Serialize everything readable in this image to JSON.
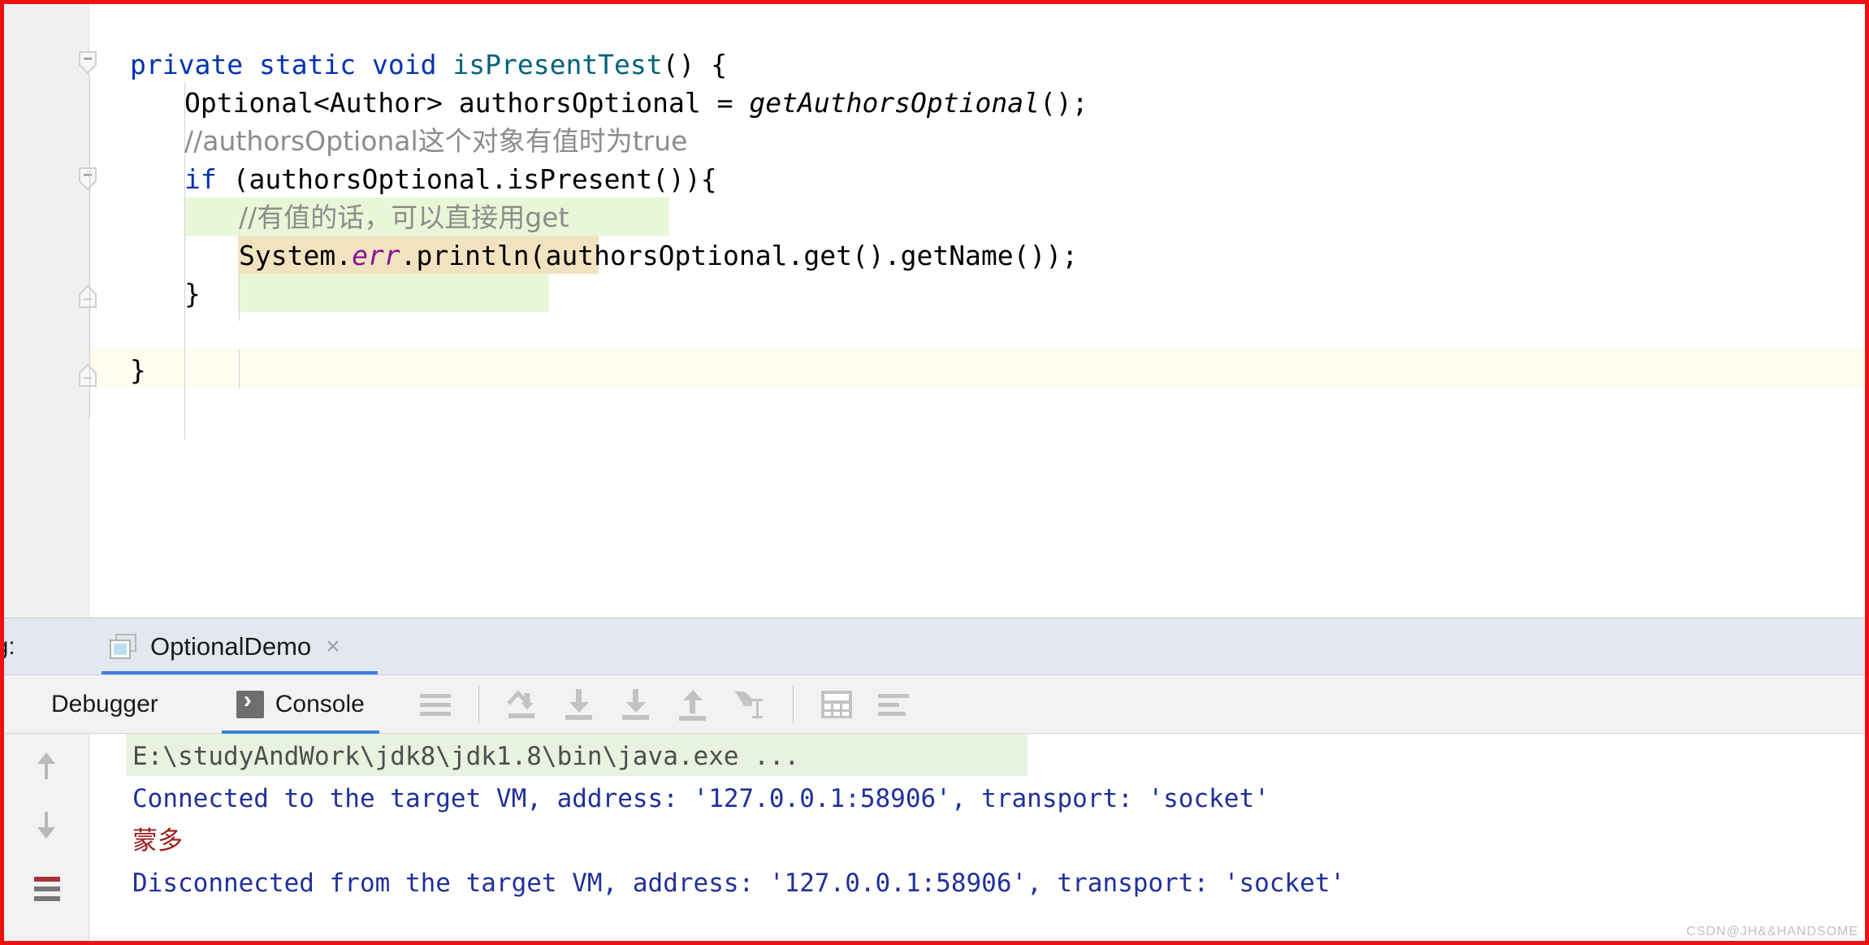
{
  "editor": {
    "lines": [
      {
        "indent": 1,
        "segments": [
          {
            "t": "private ",
            "c": "kw"
          },
          {
            "t": "static ",
            "c": "kw"
          },
          {
            "t": "void ",
            "c": "kw"
          },
          {
            "t": "isPresentTest",
            "c": "method"
          },
          {
            "t": "() {",
            "c": "plain"
          }
        ]
      },
      {
        "indent": 2,
        "segments": [
          {
            "t": "Optional<Author> authorsOptional = ",
            "c": "plain"
          },
          {
            "t": "getAuthorsOptional",
            "c": "static-it"
          },
          {
            "t": "();",
            "c": "plain"
          }
        ]
      },
      {
        "indent": 2,
        "segments": [
          {
            "t": "//authorsOptional这个对象有值时为true",
            "c": "comment"
          }
        ]
      },
      {
        "indent": 2,
        "segments": [
          {
            "t": "if ",
            "c": "kw"
          },
          {
            "t": "(authorsOptional.isPresent()){",
            "c": "plain"
          }
        ]
      },
      {
        "indent": 3,
        "segments": [
          {
            "t": "//有值的话，可以直接用get",
            "c": "comment"
          }
        ]
      },
      {
        "indent": 3,
        "segments": [
          {
            "t": "System.",
            "c": "plain"
          },
          {
            "t": "err",
            "c": "field-it"
          },
          {
            "t": ".println(authorsOptional.get().getName());",
            "c": "plain"
          }
        ]
      },
      {
        "indent": 2,
        "segments": [
          {
            "t": "}",
            "c": "plain"
          }
        ]
      },
      {
        "indent": 0,
        "segments": []
      },
      {
        "indent": 1,
        "segments": [
          {
            "t": "}",
            "c": "plain"
          }
        ]
      }
    ],
    "fold_icons": [
      "fold-minus-icon",
      "fold-minus-icon",
      "fold-end-icon",
      "fold-end-icon"
    ]
  },
  "debug": {
    "panel_label": "ug:",
    "run_tab": {
      "name": "OptionalDemo",
      "close": "×",
      "icon": "run-configuration-icon"
    },
    "tabs": [
      {
        "label": "Debugger",
        "selected": false,
        "icon": null
      },
      {
        "label": "Console",
        "selected": true,
        "icon": "console-icon"
      }
    ],
    "toolbar_icons": [
      "soft-wrap-icon",
      "step-over-icon",
      "step-into-icon",
      "force-step-into-icon",
      "step-out-icon",
      "run-to-cursor-icon",
      "evaluate-expression-icon",
      "settings-lines-icon"
    ],
    "side_buttons": [
      "scroll-up-icon",
      "scroll-down-icon",
      "print-icon"
    ]
  },
  "console": {
    "lines": [
      {
        "text": "E:\\studyAndWork\\jdk8\\jdk1.8\\bin\\java.exe ...",
        "color": "c-gray",
        "highlight": true,
        "hl_width": 1110
      },
      {
        "text": "Connected to the target VM, address: '127.0.0.1:58906', transport: 'socket'",
        "color": "c-blue",
        "highlight": false,
        "hl_width": 0
      },
      {
        "text": "蒙多",
        "color": "c-red",
        "highlight": false,
        "hl_width": 0
      },
      {
        "text": "Disconnected from the target VM, address: '127.0.0.1:58906', transport: 'socket'",
        "color": "c-blue",
        "highlight": false,
        "hl_width": 0
      }
    ]
  },
  "watermark": "CSDN@JH&&HANDSOME"
}
